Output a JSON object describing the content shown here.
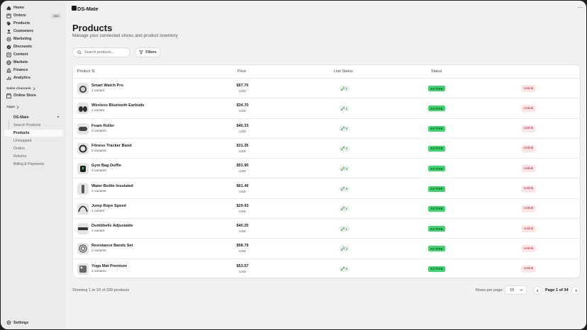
{
  "sidebar": {
    "nav": [
      {
        "label": "Home",
        "icon": "home-icon"
      },
      {
        "label": "Orders",
        "icon": "orders-icon",
        "badge": "164"
      },
      {
        "label": "Products",
        "icon": "tag-icon"
      },
      {
        "label": "Customers",
        "icon": "person-icon"
      },
      {
        "label": "Marketing",
        "icon": "target-icon"
      },
      {
        "label": "Discounts",
        "icon": "discount-icon"
      },
      {
        "label": "Content",
        "icon": "content-icon"
      },
      {
        "label": "Markets",
        "icon": "globe-icon"
      },
      {
        "label": "Finance",
        "icon": "bank-icon"
      },
      {
        "label": "Analytics",
        "icon": "chart-icon"
      }
    ],
    "sales_channels_title": "Sales channels",
    "online_store": "Online Store",
    "apps_title": "Apps",
    "app_name": "DS-Mate",
    "app_items": [
      {
        "label": "Search Products",
        "active": false
      },
      {
        "label": "Products",
        "active": true
      },
      {
        "label": "Unmapped",
        "active": false
      },
      {
        "label": "Orders",
        "active": false
      },
      {
        "label": "Returns",
        "active": false
      },
      {
        "label": "Billing & Payments",
        "active": false
      }
    ],
    "settings": "Settings"
  },
  "topbar": {
    "app_title": "DS-Mate",
    "more": "···"
  },
  "page": {
    "title": "Products",
    "subtitle": "Manage your connected stores and product inventory"
  },
  "search": {
    "placeholder": "Search products...",
    "value": ""
  },
  "filters_label": "Filters",
  "table": {
    "headers": {
      "product": "Product ⇅",
      "price": "Price",
      "link_status": "Link Status",
      "status": "Status"
    },
    "rows": [
      {
        "name": "Smart Watch Pro",
        "variants": "1 variant",
        "price": "$57.70",
        "currency": "USD",
        "links": "1",
        "status": "ACTIVE",
        "action": "Unlink"
      },
      {
        "name": "Wireless Bluetooth Earbuds",
        "variants": "1 variant",
        "price": "$34.70",
        "currency": "USD",
        "links": "1",
        "status": "ACTIVE",
        "action": "Unlink"
      },
      {
        "name": "Foam Roller",
        "variants": "2 variants",
        "price": "$40.33",
        "currency": "USD",
        "links": "2",
        "status": "ACTIVE",
        "action": "Unlink"
      },
      {
        "name": "Fitness Tracker Band",
        "variants": "2 variants",
        "price": "$31.35",
        "currency": "USD",
        "links": "2",
        "status": "ACTIVE",
        "action": "Unlink"
      },
      {
        "name": "Gym Bag Duffle",
        "variants": "3 variants",
        "price": "$53.90",
        "currency": "USD",
        "links": "3",
        "status": "ACTIVE",
        "action": "Unlink"
      },
      {
        "name": "Water Bottle Insulated",
        "variants": "2 variants",
        "price": "$61.49",
        "currency": "USD",
        "links": "2",
        "status": "ACTIVE",
        "action": "Unlink"
      },
      {
        "name": "Jump Rope Speed",
        "variants": "1 variant",
        "price": "$29.93",
        "currency": "USD",
        "links": "1",
        "status": "ACTIVE",
        "action": "Unlink"
      },
      {
        "name": "Dumbbells Adjustable",
        "variants": "1 variant",
        "price": "$40.25",
        "currency": "USD",
        "links": "1",
        "status": "ACTIVE",
        "action": "Unlink"
      },
      {
        "name": "Resistance Bands Set",
        "variants": "2 variants",
        "price": "$58.79",
        "currency": "USD",
        "links": "2",
        "status": "ACTIVE",
        "action": "Unlink"
      },
      {
        "name": "Yoga Mat Premium",
        "variants": "2 variants",
        "price": "$53.57",
        "currency": "USD",
        "links": "2",
        "status": "ACTIVE",
        "action": "Unlink"
      }
    ]
  },
  "footer": {
    "showing": "Showing 1 to 10 of 339 products",
    "rows_per_page_label": "Rows per page:",
    "rows_per_page_value": "10",
    "page_text": "Page 1 of 34"
  },
  "colors": {
    "active_badge": "#3fd66f",
    "unlink_bg": "#fde5e5",
    "unlink_text": "#b0182a",
    "link_bg": "#e6f1e8"
  }
}
